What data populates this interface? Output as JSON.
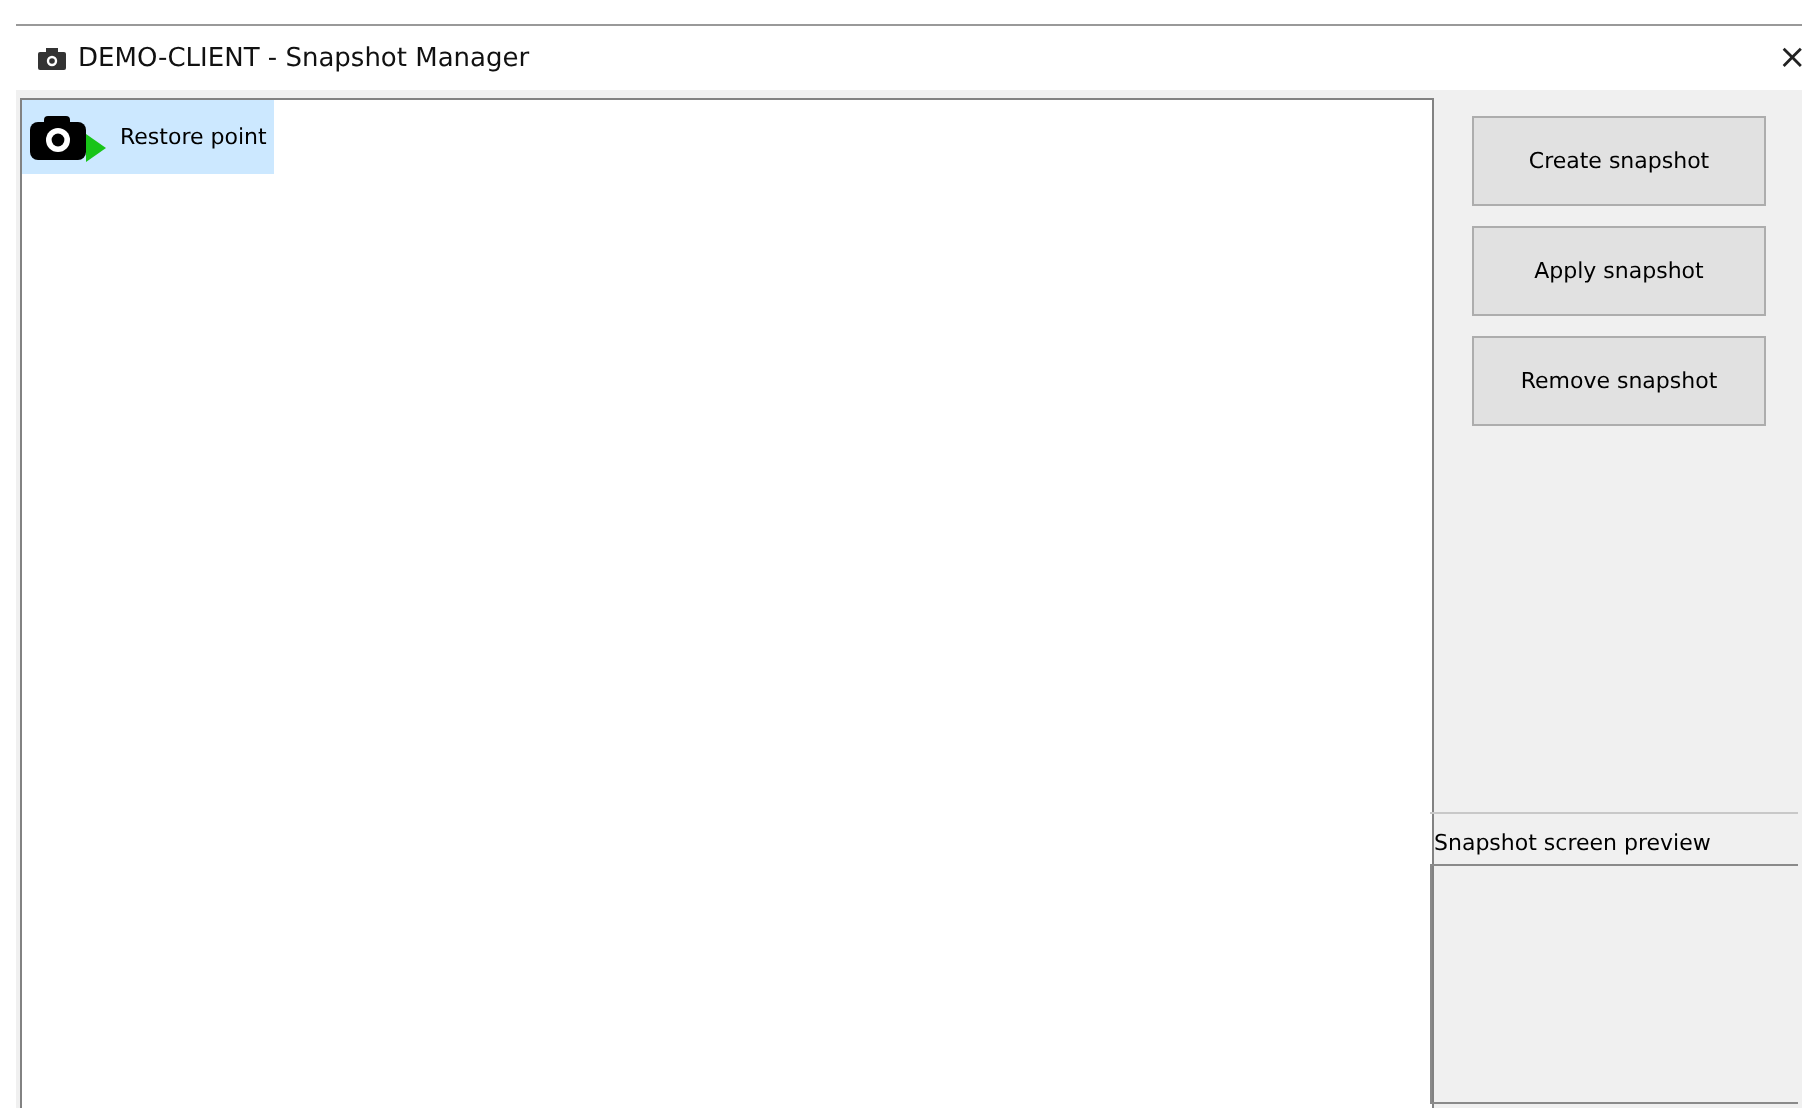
{
  "window": {
    "title": "DEMO-CLIENT - Snapshot Manager",
    "close": "×"
  },
  "snapshots": [
    {
      "name": "Restore point",
      "selected": true
    }
  ],
  "buttons": [
    "Create snapshot",
    "Apply snapshot",
    "Remove snapshot"
  ],
  "preview": {
    "label": "Snapshot screen preview"
  }
}
